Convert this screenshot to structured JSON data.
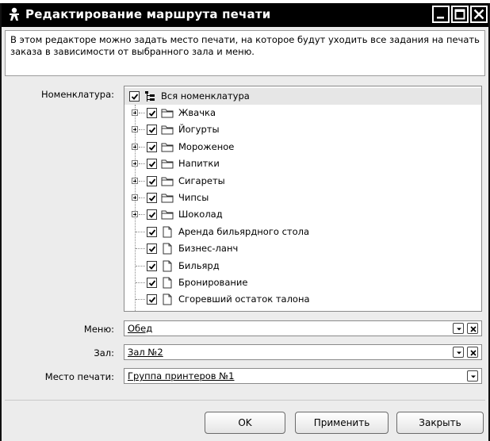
{
  "window": {
    "title": "Редактирование маршрута печати"
  },
  "description": "В этом редакторе можно задать место печати, на которое будут уходить все задания на печать заказа в зависимости от выбранного зала и меню.",
  "nomenclature": {
    "label": "Номенклатура:",
    "root": {
      "label": "Вся номенклатура",
      "checked": true,
      "icon": "tree-hierarchy-icon"
    },
    "items": [
      {
        "label": "Жвачка",
        "type": "folder",
        "checked": true,
        "expandable": true
      },
      {
        "label": "Йогурты",
        "type": "folder",
        "checked": true,
        "expandable": true
      },
      {
        "label": "Мороженое",
        "type": "folder",
        "checked": true,
        "expandable": true
      },
      {
        "label": "Напитки",
        "type": "folder",
        "checked": true,
        "expandable": true
      },
      {
        "label": "Сигареты",
        "type": "folder",
        "checked": true,
        "expandable": true
      },
      {
        "label": "Чипсы",
        "type": "folder",
        "checked": true,
        "expandable": true
      },
      {
        "label": "Шоколад",
        "type": "folder",
        "checked": true,
        "expandable": true
      },
      {
        "label": "Аренда бильярдного стола",
        "type": "document",
        "checked": true,
        "expandable": false
      },
      {
        "label": "Бизнес-ланч",
        "type": "document",
        "checked": true,
        "expandable": false
      },
      {
        "label": "Бильярд",
        "type": "document",
        "checked": true,
        "expandable": false
      },
      {
        "label": "Бронирование",
        "type": "document",
        "checked": true,
        "expandable": false
      },
      {
        "label": "Сгоревший остаток талона",
        "type": "document",
        "checked": true,
        "expandable": false
      }
    ]
  },
  "menu": {
    "label": "Меню:",
    "value": "Обед"
  },
  "hall": {
    "label": "Зал:",
    "value": "Зал №2"
  },
  "print_place": {
    "label": "Место печати:",
    "value": "Группа принтеров №1"
  },
  "buttons": {
    "ok": "OK",
    "apply": "Применить",
    "close": "Закрыть"
  }
}
